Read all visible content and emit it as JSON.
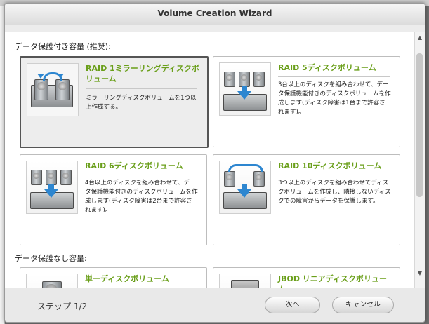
{
  "window": {
    "title": "Volume Creation Wizard"
  },
  "sections": {
    "protected_label": "データ保護付き容量 (推奨):",
    "unprotected_label": "データ保護なし容量:"
  },
  "options": [
    {
      "title": "RAID 1ミラーリングディスクボリューム",
      "desc": "ミラーリングディスクボリュームを1つ以上作成する。",
      "selected": true
    },
    {
      "title": "RAID 5ディスクボリューム",
      "desc": "3台以上のディスクを組み合わせて、データ保護機能付きのディスクボリュームを作成します(ディスク障害は1台まで許容されます)。",
      "selected": false
    },
    {
      "title": "RAID 6ディスクボリューム",
      "desc": "4台以上のディスクを組み合わせて、データ保護機能付きのディスクボリュームを作成します(ディスク障害は2台まで許容されます)。",
      "selected": false
    },
    {
      "title": "RAID 10ディスクボリューム",
      "desc": "3つ以上のディスクを組み合わせてディスクボリュームを作成し、隣接しないディスクでの障害からデータを保護します。",
      "selected": false
    },
    {
      "title": "単一ディスクボリューム",
      "desc": "",
      "selected": false
    },
    {
      "title": "JBOD リニアディスクボリューム",
      "desc": "",
      "selected": false
    }
  ],
  "footer": {
    "step": "ステップ 1/2",
    "next_label": "次へ",
    "cancel_label": "キャンセル"
  },
  "colors": {
    "accent_title": "#6a9f1a",
    "arrow": "#2d86d0",
    "selected_border": "#555555"
  }
}
